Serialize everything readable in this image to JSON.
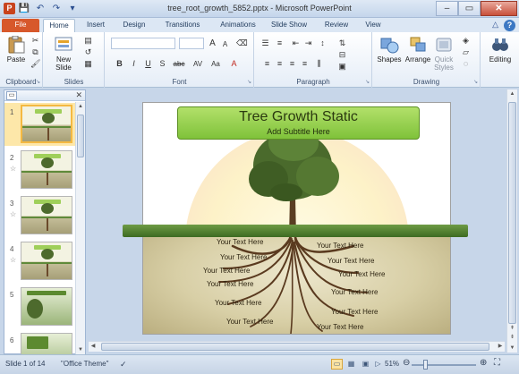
{
  "window": {
    "title": "tree_root_growth_5852.pptx - Microsoft PowerPoint",
    "app_icon": "P"
  },
  "tabs": [
    {
      "label": "File"
    },
    {
      "label": "Home"
    },
    {
      "label": "Insert"
    },
    {
      "label": "Design"
    },
    {
      "label": "Transitions"
    },
    {
      "label": "Animations"
    },
    {
      "label": "Slide Show"
    },
    {
      "label": "Review"
    },
    {
      "label": "View"
    }
  ],
  "ribbon": {
    "clipboard": {
      "label": "Clipboard",
      "paste": "Paste"
    },
    "slides": {
      "label": "Slides",
      "new_slide": "New Slide"
    },
    "font": {
      "label": "Font",
      "grow": "A",
      "shrink": "A",
      "bold": "B",
      "italic": "I",
      "underline": "U",
      "strike": "S",
      "shadow": "abc",
      "spacing": "AV",
      "case": "Aa",
      "color": "A"
    },
    "paragraph": {
      "label": "Paragraph"
    },
    "drawing": {
      "label": "Drawing",
      "shapes": "Shapes",
      "arrange": "Arrange",
      "quick_styles": "Quick Styles"
    },
    "editing": {
      "label": "Editing"
    }
  },
  "slides_pane": {
    "thumbnails": [
      {
        "num": "1",
        "star": "",
        "selected": true
      },
      {
        "num": "2",
        "star": "☆",
        "selected": false
      },
      {
        "num": "3",
        "star": "☆",
        "selected": false
      },
      {
        "num": "4",
        "star": "☆",
        "selected": false
      },
      {
        "num": "5",
        "star": "",
        "selected": false
      },
      {
        "num": "6",
        "star": "",
        "selected": false
      }
    ]
  },
  "slide": {
    "title": "Tree Growth Static",
    "subtitle": "Add Subtitle Here",
    "placeholder_text": "Your Text Here"
  },
  "statusbar": {
    "slide_info": "Slide 1 of 14",
    "theme": "\"Office Theme\"",
    "zoom": "51%",
    "zoom_level": 0.51
  },
  "colors": {
    "accent_file_tab": "#d7582b",
    "title_box": "#9fd152",
    "selection": "#f4b942"
  }
}
